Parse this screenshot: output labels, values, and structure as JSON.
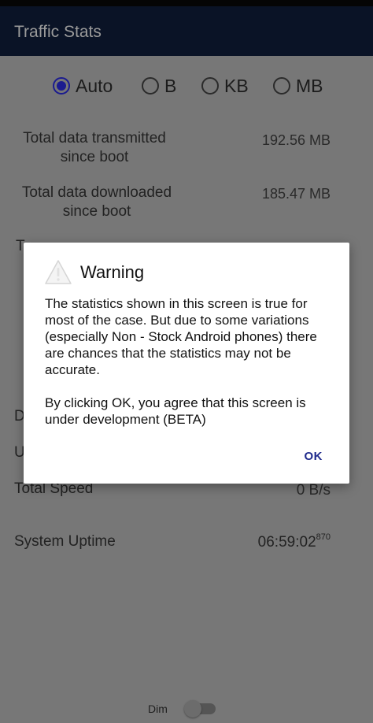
{
  "app_bar": {
    "title": "Traffic Stats"
  },
  "units": {
    "selected": "Auto",
    "options": [
      "Auto",
      "B",
      "KB",
      "MB"
    ]
  },
  "stats": {
    "transmitted": {
      "label_line1": "Total data transmitted",
      "label_line2": "since boot",
      "value": "192.56 MB"
    },
    "downloaded": {
      "label_line1": "Total data downloaded",
      "label_line2": "since boot",
      "value": "185.47 MB"
    },
    "partial_label_1": "T",
    "partial_label_2": "D",
    "partial_label_3": "U",
    "total_speed": {
      "label": "Total Speed",
      "value": "0 B/s"
    },
    "uptime": {
      "label": "System Uptime",
      "value": "06:59:02",
      "fraction": "870"
    }
  },
  "dim": {
    "label": "Dim",
    "enabled": false
  },
  "dialog": {
    "title": "Warning",
    "message_1": "The statistics shown in this screen is true for most of the case. But due to some variations (especially Non - Stock Android phones) there are chances that the statistics may not be accurate.",
    "message_2": "By clicking OK, you agree that this screen is under development (BETA)",
    "ok_label": "OK"
  },
  "colors": {
    "app_bar": "#0a1326",
    "accent": "#1b1b8f",
    "scrim_background": "#777777",
    "dialog_button": "#1f2a8c"
  }
}
